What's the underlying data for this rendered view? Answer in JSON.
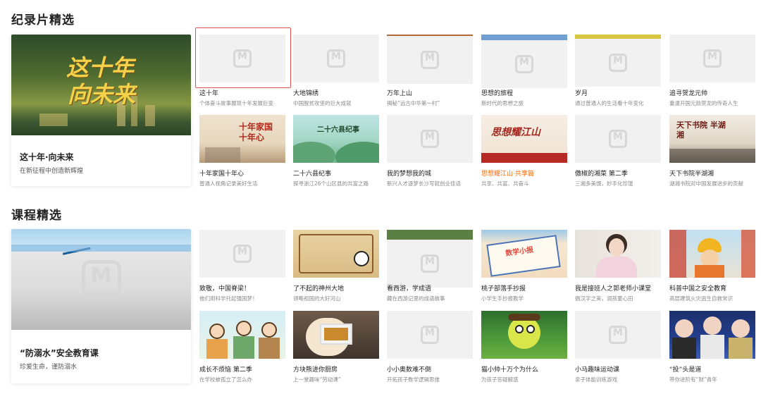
{
  "sections": [
    {
      "title": "纪录片精选",
      "feature": {
        "title": "这十年·向未来",
        "subtitle": "在新征程中创造新辉煌",
        "poster_text_1": "这十年",
        "poster_text_2": "向未来"
      },
      "cards": [
        {
          "title": "这十年",
          "desc": "个体奋斗故事展现十年发展巨变"
        },
        {
          "title": "大地锦绣",
          "desc": "中国脱贫攻坚的巨大成就"
        },
        {
          "title": "万年上山",
          "desc": "揭秘“远古中华第一村”"
        },
        {
          "title": "思想的旅程",
          "desc": "新时代的思想之旅"
        },
        {
          "title": "岁月",
          "desc": "通过普通人的生活看十年变化"
        },
        {
          "title": "追寻贺龙元帅",
          "desc": "重温开国元勋贺龙的传奇人生"
        },
        {
          "title": "十年家国十年心",
          "desc": "普通人视角记录美好生活",
          "thumb_text": "十年家国 十年心"
        },
        {
          "title": "二十六县纪事",
          "desc": "探寻浙江26个山区县的共富之路",
          "thumb_text": "二十六县纪事"
        },
        {
          "title": "我的梦想我的城",
          "desc": "新兴人才逐梦长沙写就创业佳话"
        },
        {
          "title": "思想耀江山·共享篇",
          "desc": "共享、共富、共奋斗",
          "thumb_text": "思想耀江山"
        },
        {
          "title": "傲椒的湘菜 第二季",
          "desc": "三湘多美馔，妙手化珍馐"
        },
        {
          "title": "天下书院半湖湘",
          "desc": "湖湘书院对中国发展进步的贡献",
          "thumb_text": "天下书院 半湖湘"
        }
      ]
    },
    {
      "title": "课程精选",
      "feature": {
        "title": "“防溺水”安全教育课",
        "subtitle": "珍爱生命，谨防溺水"
      },
      "cards": [
        {
          "title": "致敬，中国脊梁！",
          "desc": "他们用科学托起强国梦！"
        },
        {
          "title": "了不起的神州大地",
          "desc": "领略祖国的大好河山"
        },
        {
          "title": "看西游，学成语",
          "desc": "藏在西游记里的成语故事"
        },
        {
          "title": "桃子部落手抄报",
          "desc": "小学生手抄报教学",
          "thumb_text": "数学小报"
        },
        {
          "title": "我是接班人之郭老师小课堂",
          "desc": "倡汉字之美，润孩童心田"
        },
        {
          "title": "科普中国之安全教育",
          "desc": "高层建筑火灾逃生自救常识"
        },
        {
          "title": "成长不烦恼 第二季",
          "desc": "在学校被孤立了怎么办"
        },
        {
          "title": "方块熊进你厨房",
          "desc": "上一堂趣味“劳动课”"
        },
        {
          "title": "小小奥数难不倒",
          "desc": "开拓孩子数学逻辑思维"
        },
        {
          "title": "猫小帅十万个为什么",
          "desc": "为孩子答疑解惑"
        },
        {
          "title": "小马趣味运动课",
          "desc": "亲子体能训练游戏"
        },
        {
          "title": "“投”头是道",
          "desc": "带你进阶有“财”青年"
        }
      ]
    }
  ],
  "colors": {
    "accent": "#ff6a00",
    "selection": "#e05050"
  }
}
